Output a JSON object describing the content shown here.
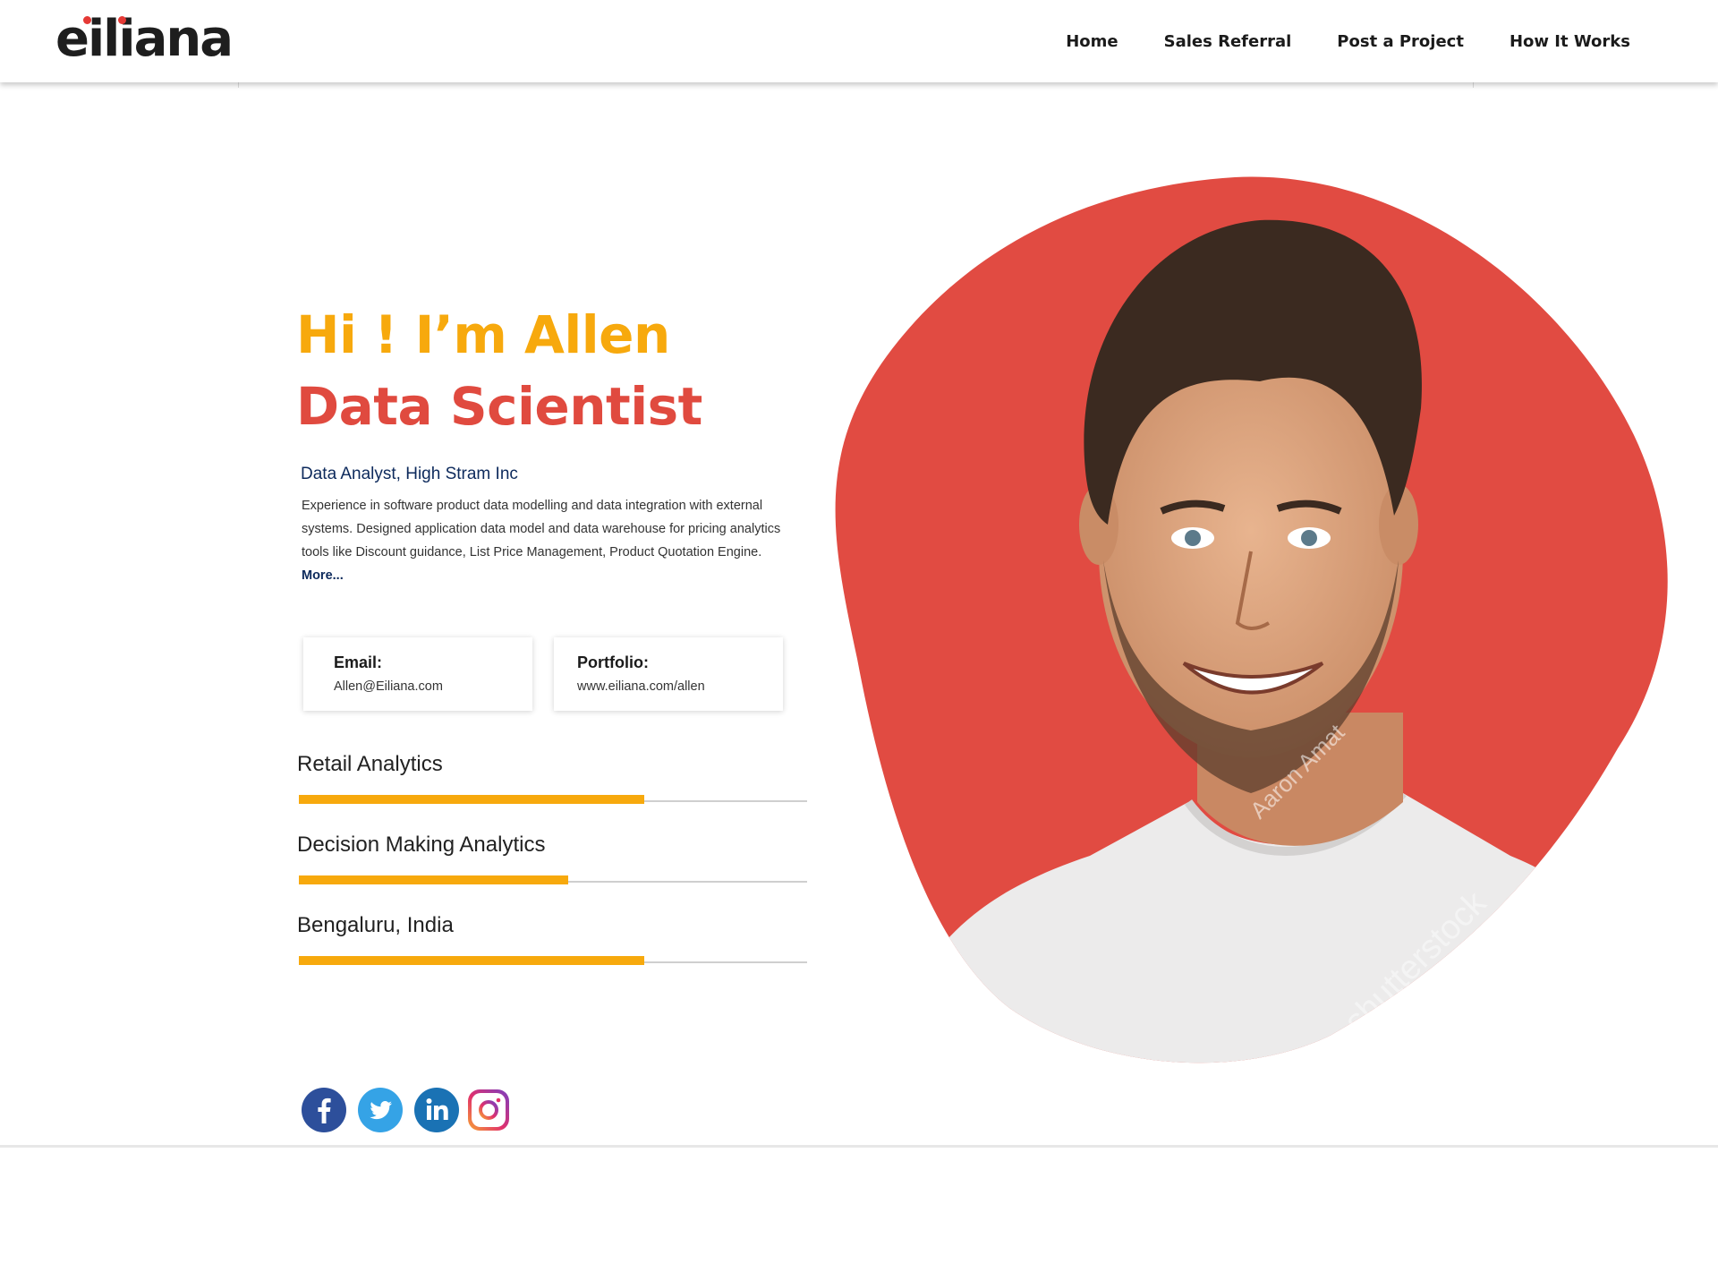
{
  "header": {
    "logo_text": "eiliana",
    "nav": [
      "Home",
      "Sales Referral",
      "Post a Project",
      "How It Works"
    ]
  },
  "hero": {
    "greeting": "Hi ! I’m Allen",
    "role": "Data Scientist",
    "subtitle": "Data Analyst, High Stram Inc",
    "description": "Experience in software product data modelling and data integration with external systems. Designed application data model and data warehouse for pricing analytics tools like Discount guidance, List Price Management, Product Quotation Engine.",
    "more_label": "More..."
  },
  "contact": {
    "email_label": "Email:",
    "email_value": "Allen@Eiliana.com",
    "portfolio_label": "Portfolio:",
    "portfolio_value": "www.eiliana.com/allen"
  },
  "skills": [
    {
      "name": "Retail Analytics",
      "level": 0.68
    },
    {
      "name": "Decision Making Analytics",
      "level": 0.53
    },
    {
      "name": "Bengaluru, India",
      "level": 0.68
    }
  ],
  "photo": {
    "watermark_1": "Aaron Amat",
    "watermark_2": "shutterstock"
  },
  "social": [
    "facebook-icon",
    "twitter-icon",
    "linkedin-icon",
    "instagram-icon"
  ],
  "colors": {
    "accent_orange": "#f7a90d",
    "accent_red": "#e04a3f",
    "navy": "#0d2a5c"
  }
}
